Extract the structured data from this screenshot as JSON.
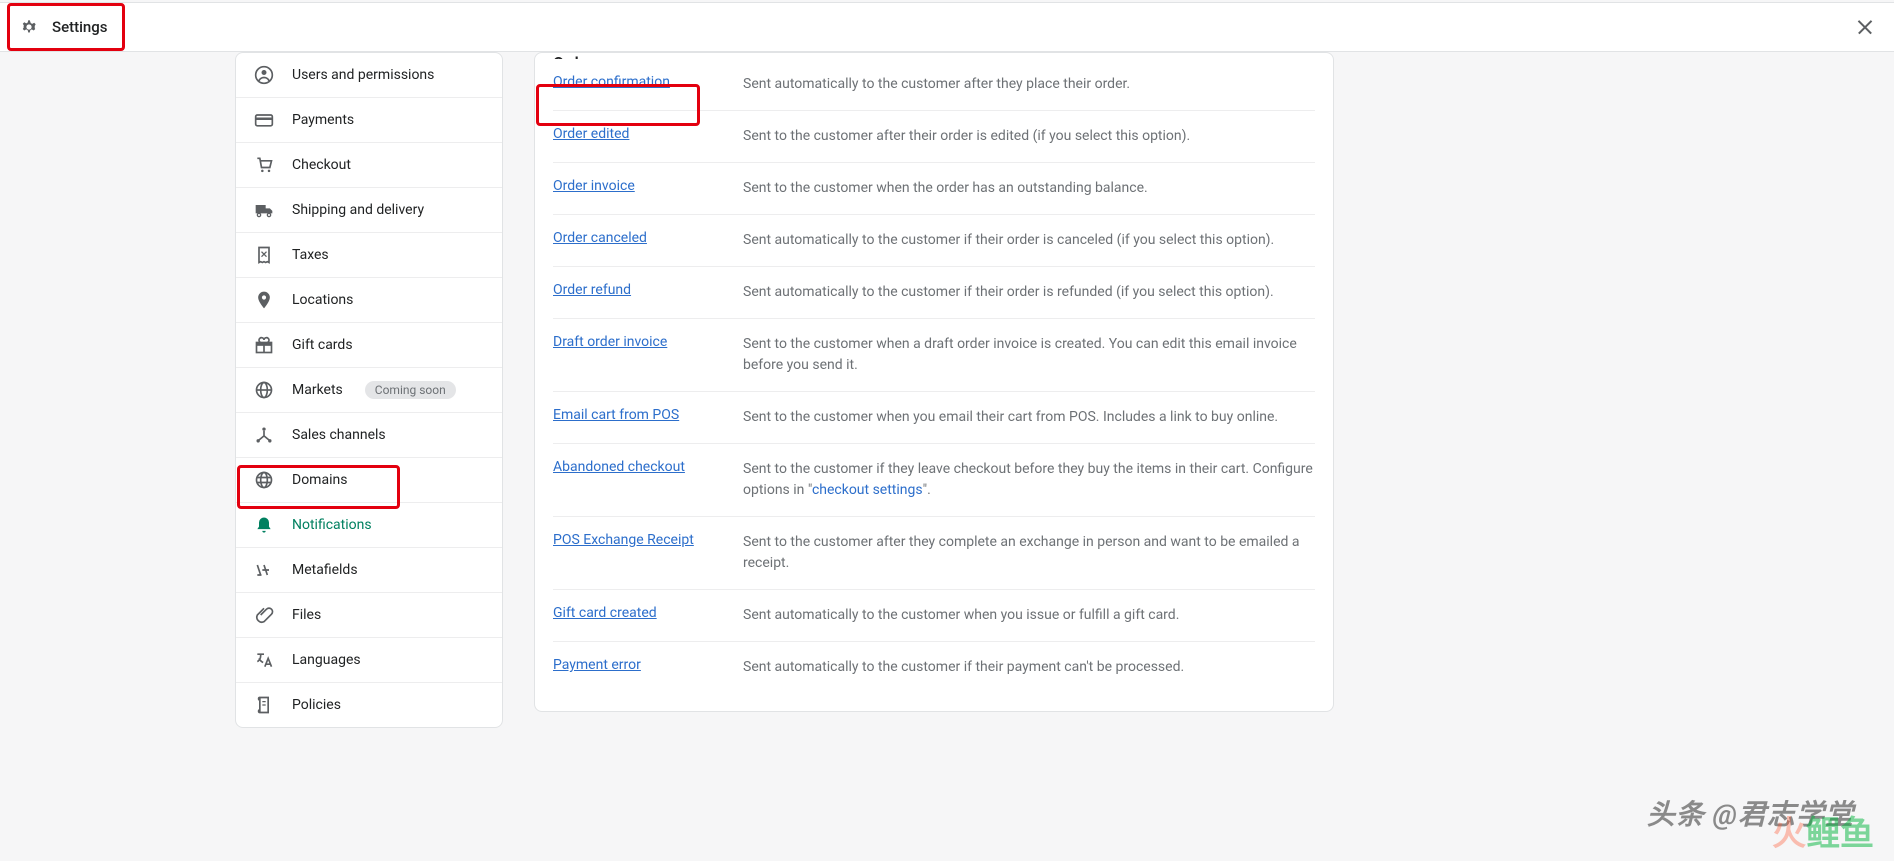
{
  "header": {
    "title": "Settings"
  },
  "sidebar": {
    "items": [
      {
        "icon": "user-circle",
        "label": "Users and permissions"
      },
      {
        "icon": "credit-card",
        "label": "Payments"
      },
      {
        "icon": "cart",
        "label": "Checkout"
      },
      {
        "icon": "truck",
        "label": "Shipping and delivery"
      },
      {
        "icon": "receipt",
        "label": "Taxes"
      },
      {
        "icon": "pin",
        "label": "Locations"
      },
      {
        "icon": "gift",
        "label": "Gift cards"
      },
      {
        "icon": "globe",
        "label": "Markets",
        "badge": "Coming soon"
      },
      {
        "icon": "channels",
        "label": "Sales channels"
      },
      {
        "icon": "globe-domain",
        "label": "Domains"
      },
      {
        "icon": "bell",
        "label": "Notifications",
        "active": true
      },
      {
        "icon": "metafields",
        "label": "Metafields"
      },
      {
        "icon": "clip",
        "label": "Files"
      },
      {
        "icon": "languages",
        "label": "Languages"
      },
      {
        "icon": "policies",
        "label": "Policies"
      }
    ]
  },
  "main": {
    "section_title": "Orders",
    "checkout_settings_label": "checkout settings",
    "rows": [
      {
        "link": "Order confirmation",
        "desc": "Sent automatically to the customer after they place their order."
      },
      {
        "link": "Order edited",
        "desc": "Sent to the customer after their order is edited (if you select this option)."
      },
      {
        "link": "Order invoice",
        "desc": "Sent to the customer when the order has an outstanding balance."
      },
      {
        "link": "Order canceled",
        "desc": "Sent automatically to the customer if their order is canceled (if you select this option)."
      },
      {
        "link": "Order refund",
        "desc": "Sent automatically to the customer if their order is refunded (if you select this option)."
      },
      {
        "link": "Draft order invoice",
        "desc": "Sent to the customer when a draft order invoice is created. You can edit this email invoice before you send it."
      },
      {
        "link": "Email cart from POS",
        "desc": "Sent to the customer when you email their cart from POS. Includes a link to buy online."
      },
      {
        "link": "Abandoned checkout",
        "desc": "Sent to the customer if they leave checkout before they buy the items in their cart. Configure options in \"",
        "link_in_desc": "checkout settings",
        "desc_tail": "\"."
      },
      {
        "link": "POS Exchange Receipt",
        "desc": "Sent to the customer after they complete an exchange in person and want to be emailed a receipt."
      },
      {
        "link": "Gift card created",
        "desc": "Sent automatically to the customer when you issue or fulfill a gift card."
      },
      {
        "link": "Payment error",
        "desc": "Sent automatically to the customer if their payment can't be processed."
      }
    ]
  },
  "watermark": {
    "line1": "头条 @君志学堂",
    "line2_a": "火",
    "line2_b": "鲤鱼"
  }
}
